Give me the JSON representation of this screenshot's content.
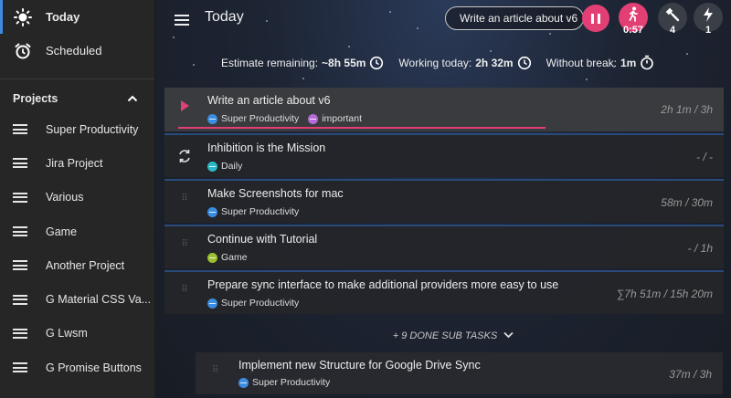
{
  "sidebar": {
    "nav": [
      {
        "label": "Today",
        "icon": "sun-icon"
      },
      {
        "label": "Scheduled",
        "icon": "alarm-clock-icon"
      }
    ],
    "projects_heading": "Projects",
    "projects": [
      {
        "label": "Super Productivity"
      },
      {
        "label": "Jira Project"
      },
      {
        "label": "Various"
      },
      {
        "label": "Game"
      },
      {
        "label": "Another Project"
      },
      {
        "label": "G Material CSS Va..."
      },
      {
        "label": "G Lwsm"
      },
      {
        "label": "G Promise Buttons"
      }
    ]
  },
  "header": {
    "title": "Today",
    "current_task": "Write an article about v6",
    "focus_timer": "0:57",
    "tool_count": "4",
    "flash_count": "1"
  },
  "stats": {
    "estimate_label": "Estimate remaining:",
    "estimate_value": "~8h 55m",
    "working_label": "Working today:",
    "working_value": "2h 32m",
    "break_label": "Without break:",
    "break_value": "1m"
  },
  "tasks": [
    {
      "title": "Write an article about v6",
      "tags": [
        {
          "label": "Super Productivity",
          "color": "#3b8de0"
        },
        {
          "label": "important",
          "color": "#b56bd6"
        }
      ],
      "time": "2h 1m / 3h"
    },
    {
      "title": "Inhibition is the Mission",
      "tags": [
        {
          "label": "Daily",
          "color": "#2cb8c9"
        }
      ],
      "time": "- / -"
    },
    {
      "title": "Make Screenshots for mac",
      "tags": [
        {
          "label": "Super Productivity",
          "color": "#3b8de0"
        }
      ],
      "time": "58m / 30m"
    },
    {
      "title": "Continue with Tutorial",
      "tags": [
        {
          "label": "Game",
          "color": "#9bbf2e"
        }
      ],
      "time": "- / 1h"
    },
    {
      "title": "Prepare sync interface to make additional providers more easy to use",
      "tags": [
        {
          "label": "Super Productivity",
          "color": "#3b8de0"
        }
      ],
      "time": "∑7h 51m / 15h 20m"
    }
  ],
  "done_subtasks": "+ 9 DONE SUB TASKS",
  "subtask": {
    "title": "Implement new Structure for Google Drive Sync",
    "tag": "Super Productivity",
    "tag_color": "#3b8de0",
    "time": "37m / 3h"
  },
  "colors": {
    "accent": "#e23f75",
    "active_border": "#3d8ae0"
  }
}
